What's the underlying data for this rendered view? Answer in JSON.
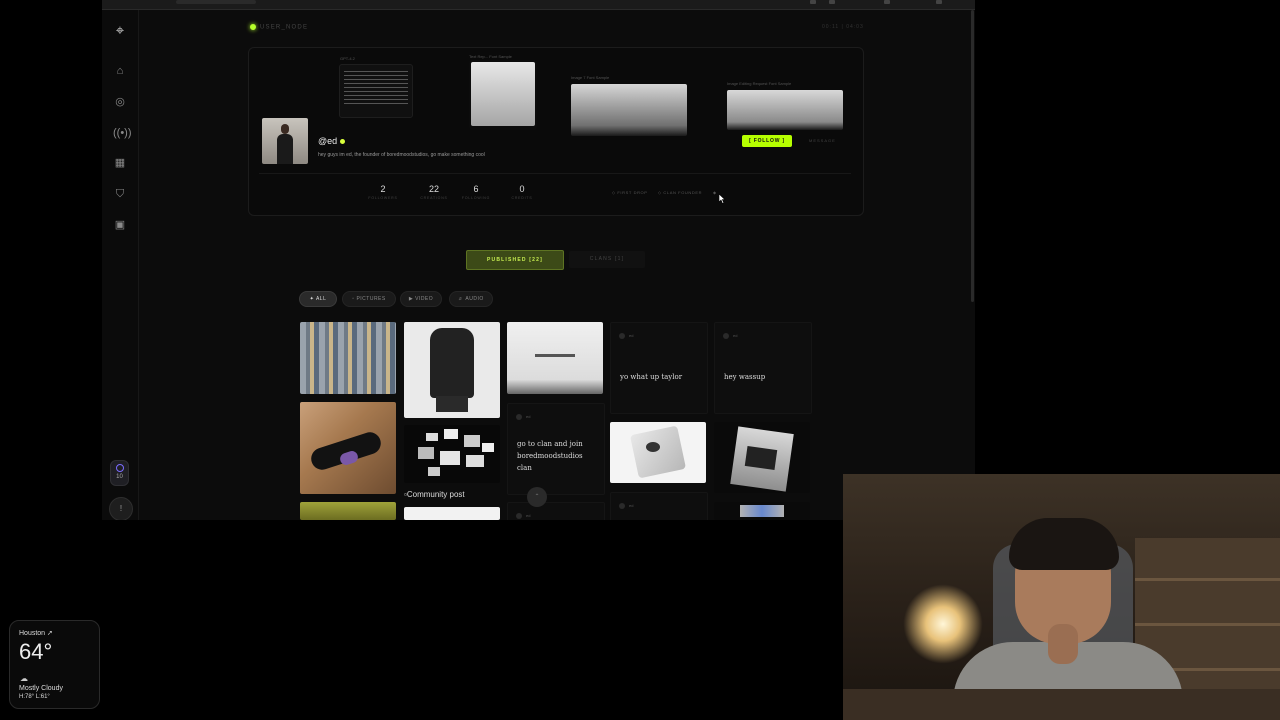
{
  "browser": {
    "url": "localhost:3000/@ed"
  },
  "rail": {
    "icons": [
      "crosshair-logo-icon",
      "home-icon",
      "compass-icon",
      "broadcast-icon",
      "calendar-icon",
      "shield-icon",
      "grid-icon"
    ],
    "badge_count": "10",
    "bottom_btn": "!"
  },
  "profile": {
    "node_label": "USER_NODE",
    "top_right": "00:11 | 04:03",
    "handle": "@ed",
    "bio": "hey guys im ed, the founder of boredmoodstudios, go make something cool",
    "follow_label": "[ FOLLOW ]",
    "message_label": "MESSAGE",
    "bg_cards": [
      {
        "caption": "GPT-4.2"
      },
      {
        "caption": "Text Rep...   Font Sample"
      },
      {
        "caption": "Image 7   Font Sample"
      },
      {
        "caption": "Image Editing Request   Font Sample"
      }
    ],
    "stats": [
      {
        "value": "2",
        "label": "FOLLOWERS"
      },
      {
        "value": "22",
        "label": "CREATIONS"
      },
      {
        "value": "6",
        "label": "FOLLOWING"
      },
      {
        "value": "0",
        "label": "CREDITS"
      }
    ],
    "badges": [
      "FIRST DROP",
      "CLAN FOUNDER"
    ]
  },
  "tabs": {
    "published": "PUBLISHED [22]",
    "clans": "CLANS [1]"
  },
  "filters": [
    {
      "label": "ALL",
      "icon": "✦",
      "active": true
    },
    {
      "label": "PICTURES",
      "icon": "▫",
      "active": false
    },
    {
      "label": "VIDEO",
      "icon": "▶",
      "active": false
    },
    {
      "label": "AUDIO",
      "icon": "♬",
      "active": false
    }
  ],
  "feed": {
    "text_posts": [
      {
        "author": "ed",
        "text": "yo what up taylor"
      },
      {
        "author": "ed",
        "text": "hey wassup"
      },
      {
        "author": "ed",
        "text": "go to clan and join boredmoodstudios clan"
      },
      {
        "author": "ed",
        "text": ""
      },
      {
        "author": "ed",
        "text": ""
      }
    ],
    "broken_image_alt": "Community post"
  },
  "weather": {
    "city": "Houston",
    "temp": "64°",
    "condition": "Mostly Cloudy",
    "high_low": "H:78° L:61°"
  },
  "colors": {
    "accent": "#b6ff00",
    "bg": "#0c0c0c"
  }
}
